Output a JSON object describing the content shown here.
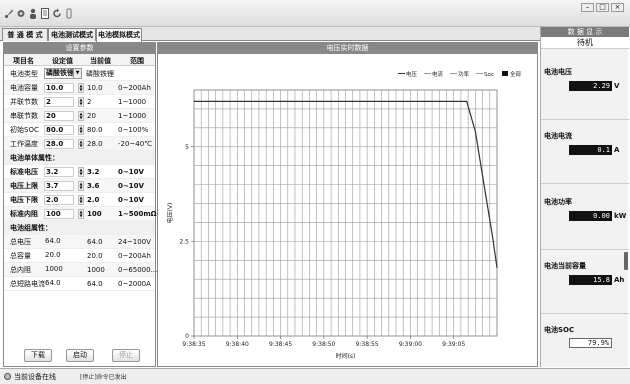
{
  "tabs": [
    {
      "label": "普 通 模 式"
    },
    {
      "label": "电池测试模式"
    },
    {
      "label": "电池模拟模式"
    }
  ],
  "params": {
    "title": "设置参数",
    "headers": [
      "项目名",
      "设定值",
      "当前值",
      "范围"
    ],
    "battery_type": {
      "label": "电池类型",
      "selected": "磷酸铁锂",
      "current": "磷酸铁锂"
    },
    "rows": [
      {
        "name": "电池容量",
        "set": "10.0",
        "cur": "10.0",
        "range": "0~200Ah"
      },
      {
        "name": "并联节数",
        "set": "2",
        "cur": "2",
        "range": "1~1000"
      },
      {
        "name": "串联节数",
        "set": "20",
        "cur": "20",
        "range": "1~1000"
      },
      {
        "name": "初始SOC",
        "set": "80.0",
        "cur": "80.0",
        "range": "0~100%"
      },
      {
        "name": "工作温度",
        "set": "28.0",
        "cur": "28.0",
        "range": "-20~40℃"
      }
    ],
    "cell_section": "电池单体属性：",
    "cell_rows": [
      {
        "name": "标准电压",
        "set": "3.2",
        "cur": "3.2",
        "range": "0~10V"
      },
      {
        "name": "电压上限",
        "set": "3.7",
        "cur": "3.6",
        "range": "0~10V"
      },
      {
        "name": "电压下限",
        "set": "2.0",
        "cur": "2.0",
        "range": "0~10V"
      },
      {
        "name": "标准内阻",
        "set": "100",
        "cur": "100",
        "range": "1~500mΩ"
      }
    ],
    "group_section": "电池组属性：",
    "group_rows": [
      {
        "name": "总电压",
        "set": "64.0",
        "cur": "64.0",
        "range": "24~100V"
      },
      {
        "name": "总容量",
        "set": "20.0",
        "cur": "20.0",
        "range": "0~200Ah"
      },
      {
        "name": "总内阻",
        "set": "1000",
        "cur": "1000",
        "range": "0~65000..."
      },
      {
        "name": "总短路电流",
        "set": "64.0",
        "cur": "64.0",
        "range": "0~2000A"
      }
    ],
    "buttons": {
      "download": "下载",
      "start": "启动",
      "stop": "停止"
    }
  },
  "chart_panel": {
    "title": "电压实时数据"
  },
  "chart_data": {
    "type": "line",
    "title": "",
    "xlabel": "时间(s)",
    "ylabel": "电压(V)",
    "x_ticks": [
      "9:38:35",
      "9:38:40",
      "9:38:45",
      "9:38:50",
      "9:38:55",
      "9:39:00",
      "9:39:05"
    ],
    "y_ticks": [
      "0",
      "2.5",
      "5"
    ],
    "ylim": [
      0,
      6.5
    ],
    "grid": true,
    "legend": [
      "电压",
      "电流",
      "功率",
      "Soc",
      "全部"
    ],
    "legend_position": "top-right",
    "series": [
      {
        "name": "电压",
        "color": "#333333",
        "points": [
          [
            0,
            6.2
          ],
          [
            31.5,
            6.2
          ],
          [
            32.5,
            5.4
          ],
          [
            33.5,
            4.0
          ],
          [
            34.5,
            2.6
          ],
          [
            35,
            1.8
          ]
        ]
      }
    ]
  },
  "display": {
    "title": "数 据 显 示",
    "status": "待机",
    "items": [
      {
        "label": "电池电压",
        "value": "2.29",
        "unit": "V"
      },
      {
        "label": "电池电流",
        "value": "0.1",
        "unit": "A"
      },
      {
        "label": "电池功率",
        "value": "0.00",
        "unit": "kW"
      },
      {
        "label": "电池当前容量",
        "value": "15.8",
        "unit": "Ah"
      },
      {
        "label": "电池SOC",
        "value": "79.9%",
        "unit": ""
      }
    ]
  },
  "statusbar": {
    "left": "当前设备在线",
    "right": "[停止]命令已发出"
  },
  "colors": {
    "panel_title": "#888888",
    "grid": "#9a9a9a",
    "series": "#333333"
  },
  "icons": [
    "wrench-icon",
    "gear-icon",
    "person-icon",
    "document-icon",
    "refresh-icon",
    "info-icon"
  ]
}
